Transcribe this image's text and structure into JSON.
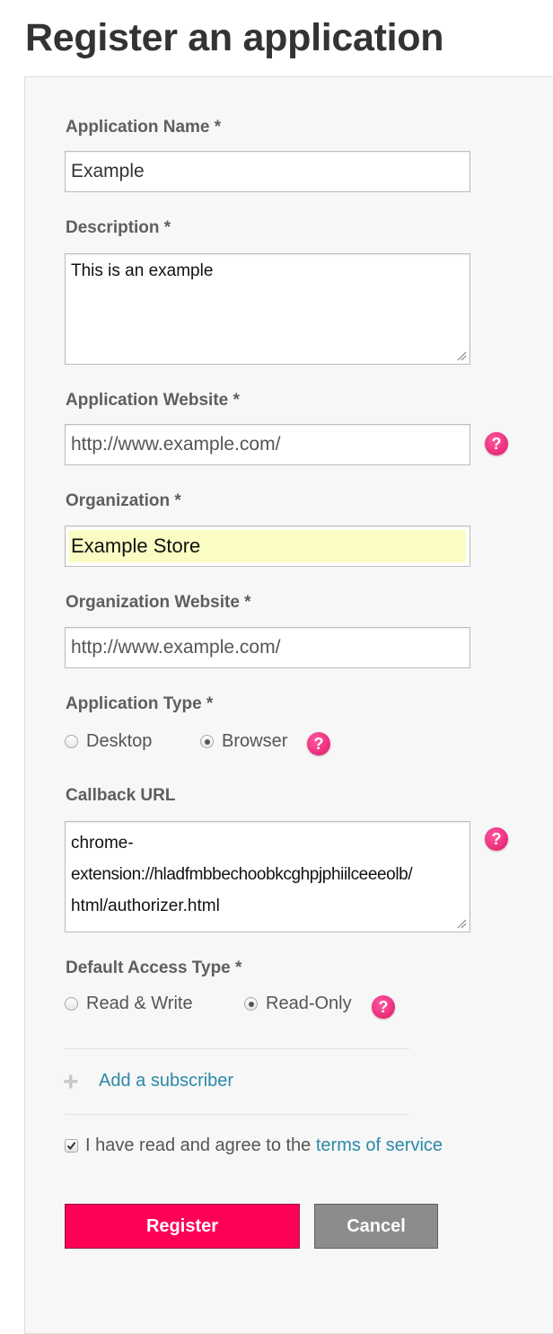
{
  "page": {
    "title": "Register an application"
  },
  "form": {
    "app_name": {
      "label": "Application Name *",
      "value": "Example"
    },
    "description": {
      "label": "Description *",
      "value": "This is an example"
    },
    "app_website": {
      "label": "Application Website *",
      "value": "http://www.example.com/"
    },
    "organization": {
      "label": "Organization *",
      "value": "Example Store"
    },
    "org_website": {
      "label": "Organization Website *",
      "value": "http://www.example.com/"
    },
    "app_type": {
      "label": "Application Type *",
      "options": [
        "Desktop",
        "Browser"
      ],
      "selected": "Browser"
    },
    "callback_url": {
      "label": "Callback URL",
      "lines": [
        "chrome-",
        "extension://hladfmbbechoobkcghpjphiilceeeolb/",
        "html/authorizer.html"
      ]
    },
    "access_type": {
      "label": "Default Access Type *",
      "options": [
        "Read & Write",
        "Read-Only"
      ],
      "selected": "Read-Only"
    },
    "add_subscriber": {
      "label": "Add a subscriber"
    },
    "terms": {
      "checked": true,
      "prefix": "I have read and agree to the",
      "link": "terms of service"
    },
    "buttons": {
      "register": "Register",
      "cancel": "Cancel"
    }
  },
  "icons": {
    "help": "help-question-icon",
    "plus": "plus-icon",
    "resize": "resize-grip-icon",
    "checkmark": "checkmark-icon"
  },
  "help_glyph": "?",
  "plus_glyph": "+",
  "colors": {
    "title": "#333333",
    "label": "#5e5e5e",
    "link": "#2a8aa8",
    "help": "#e0156a",
    "register": "#ff0059",
    "cancel": "#8c8c8c",
    "autofill": "#fafcc4",
    "panel": "#f7f7f7"
  }
}
